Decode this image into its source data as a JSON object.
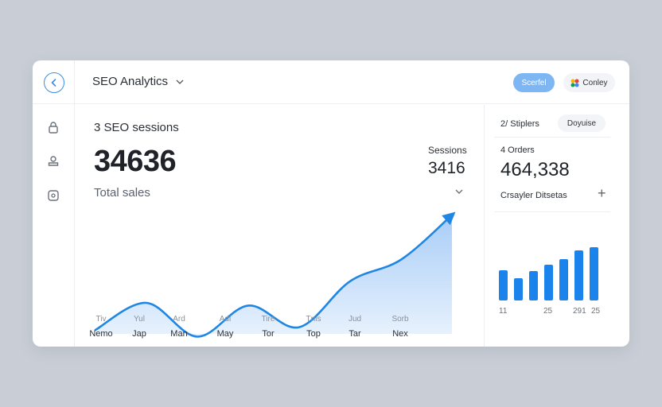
{
  "header": {
    "title": "SEO Analytics",
    "primary_button": "Scerfel",
    "connect_button": "Conley"
  },
  "main": {
    "sessions_title": "3 SEO sessions",
    "big_number": "34636",
    "big_label": "Total sales",
    "side_metric_label": "Sessions",
    "side_metric_value": "3416",
    "x_ticks": [
      "Tiv",
      "Yul",
      "Ard",
      "Adi",
      "Tire",
      "Tnis",
      "Jud",
      "Sorb"
    ],
    "x_months": [
      "Nemo",
      "Jap",
      "Man",
      "May",
      "Tor",
      "Top",
      "Tar",
      "Nex"
    ]
  },
  "right_panel": {
    "label1": "2/ Stiplers",
    "button": "Doyuise",
    "orders_label": "4 Orders",
    "orders_value": "464,338",
    "details_label": "Crsayler Ditsetas",
    "bar_ticks": [
      "11",
      "25",
      "291",
      "25"
    ]
  },
  "colors": {
    "accent": "#1f86e3",
    "area_fill": "#cfe3fb",
    "bars": "#1a84ec"
  },
  "chart_data": [
    {
      "type": "area",
      "x": [
        "Nemo",
        "Jap",
        "Man",
        "May",
        "Tor",
        "Top",
        "Tar",
        "Nex"
      ],
      "values": [
        10,
        30,
        5,
        28,
        12,
        46,
        62,
        95
      ],
      "ylim": [
        0,
        100
      ]
    },
    {
      "type": "bar",
      "values": [
        38,
        28,
        37,
        45,
        52,
        63,
        67
      ],
      "ylim": [
        0,
        70
      ]
    }
  ]
}
